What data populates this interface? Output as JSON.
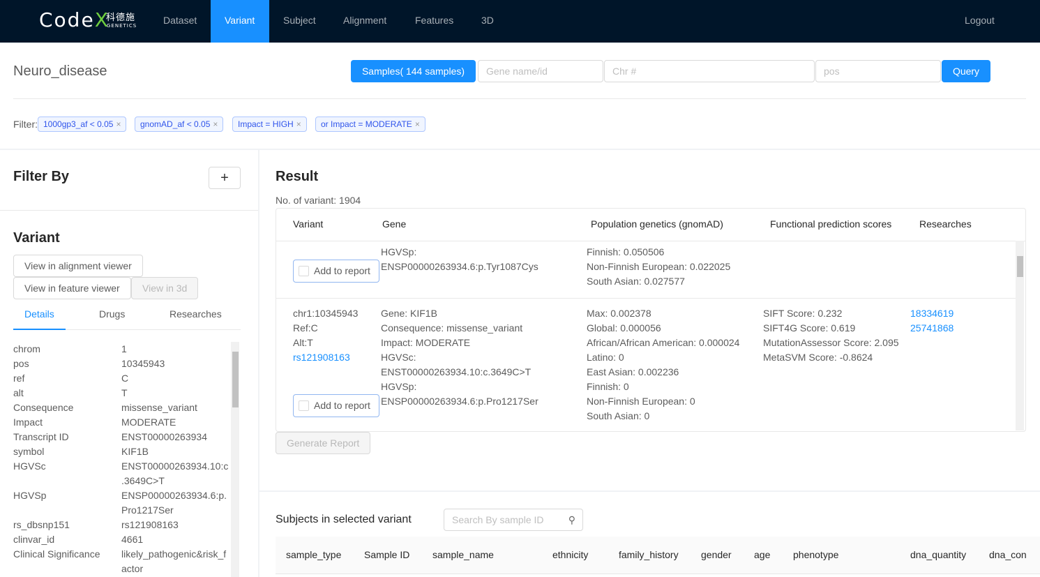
{
  "nav": {
    "logo": "CodeX",
    "logo_cn": "科德施",
    "logo_sub": "GENETICS",
    "items": [
      "Dataset",
      "Variant",
      "Subject",
      "Alignment",
      "Features",
      "3D"
    ],
    "active": "Variant",
    "logout": "Logout"
  },
  "top": {
    "title": "Neuro_disease",
    "samples_btn": "Samples( 144 samples)",
    "gene_placeholder": "Gene name/id",
    "chr_placeholder": "Chr #",
    "pos_placeholder": "pos",
    "query": "Query",
    "filter_label": "Filter:",
    "tags": [
      "1000gp3_af < 0.05",
      "gnomAD_af < 0.05",
      "Impact = HIGH",
      "or Impact = MODERATE"
    ]
  },
  "left": {
    "filter_by": "Filter By",
    "add": "+",
    "variant": "Variant",
    "btn_alignment": "View in alignment viewer",
    "btn_feature": "View in feature viewer",
    "btn_3d": "View in 3d",
    "tabs": [
      "Details",
      "Drugs",
      "Researches"
    ],
    "details": [
      [
        "chrom",
        "1"
      ],
      [
        "pos",
        "10345943"
      ],
      [
        "ref",
        "C"
      ],
      [
        "alt",
        "T"
      ],
      [
        "Consequence",
        "missense_variant"
      ],
      [
        "Impact",
        "MODERATE"
      ],
      [
        "Transcript ID",
        "ENST00000263934"
      ],
      [
        "symbol",
        "KIF1B"
      ],
      [
        "HGVSc",
        "ENST00000263934.10:c\n.3649C>T"
      ],
      [
        "HGVSp",
        "ENSP00000263934.6:p.\nPro1217Ser"
      ],
      [
        "rs_dbsnp151",
        "rs121908163"
      ],
      [
        "clinvar_id",
        "4661"
      ],
      [
        "Clinical Significance",
        "likely_pathogenic&risk_f\nactor"
      ]
    ]
  },
  "result": {
    "title": "Result",
    "count": "No. of variant: 1904",
    "columns": [
      "Variant",
      "Gene",
      "Population genetics (gnomAD)",
      "Functional prediction scores",
      "Researches"
    ],
    "add_to_report": "Add to report",
    "row1": {
      "gene": [
        "HGVSp:",
        "ENSP00000263934.6:p.Tyr1087Cys"
      ],
      "pop": [
        "Finnish: 0.050506",
        "Non-Finnish European: 0.022025",
        "South Asian: 0.027577"
      ]
    },
    "row2": {
      "variant": [
        "chr1:10345943",
        "Ref:C",
        "Alt:T"
      ],
      "rs": "rs121908163",
      "gene": [
        "Gene: KIF1B",
        "Consequence: missense_variant",
        "Impact: MODERATE",
        "HGVSc:",
        "ENST00000263934.10:c.3649C>T",
        "HGVSp:",
        "ENSP00000263934.6:p.Pro1217Ser"
      ],
      "pop": [
        "Max: 0.002378",
        "Global: 0.000056",
        "African/African American: 0.000024",
        "Latino: 0",
        "East Asian: 0.002236",
        "Finnish: 0",
        "Non-Finnish European: 0",
        "South Asian: 0"
      ],
      "scores": [
        "SIFT Score: 0.232",
        "SIFT4G Score: 0.619",
        "MutationAssessor Score: 2.095",
        "MetaSVM Score: -0.8624"
      ],
      "researches": [
        "18334619",
        "25741868"
      ]
    },
    "generate": "Generate Report"
  },
  "subjects": {
    "title": "Subjects in selected variant",
    "search_placeholder": "Search By sample ID",
    "columns": [
      "sample_type",
      "Sample ID",
      "sample_name",
      "ethnicity",
      "family_history",
      "gender",
      "age",
      "phenotype",
      "dna_quantity",
      "dna_con"
    ]
  }
}
